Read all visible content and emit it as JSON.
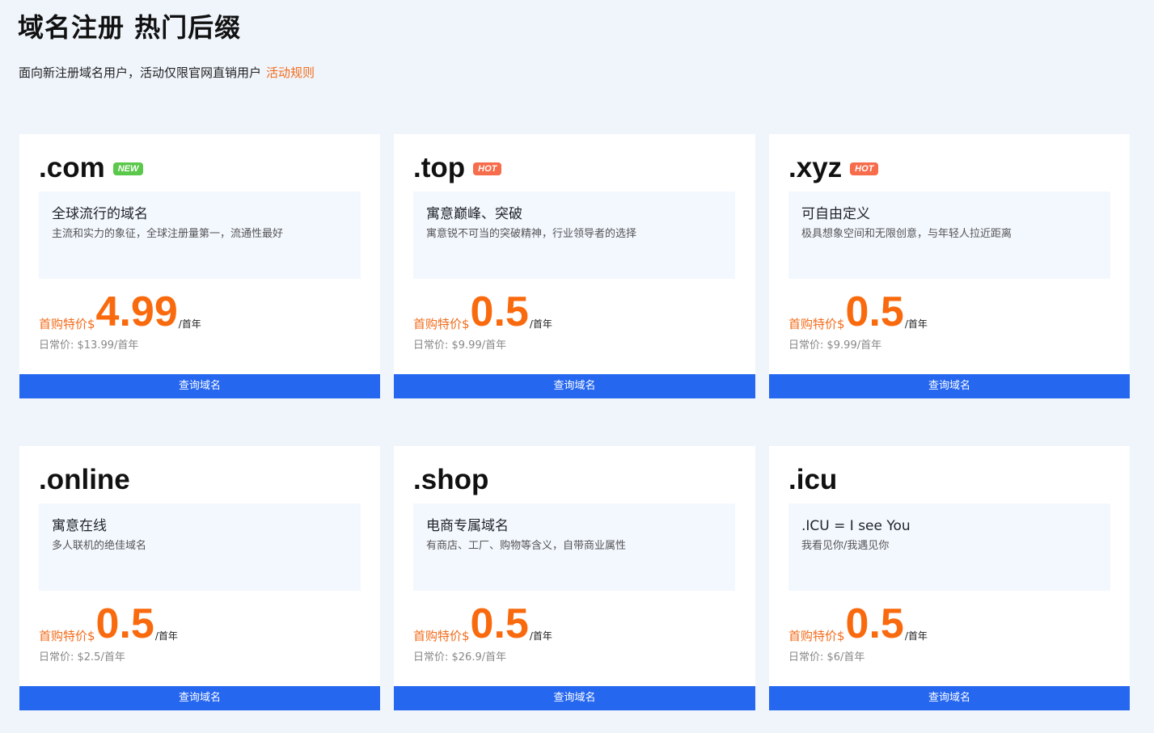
{
  "header": {
    "title": "域名注册 热门后缀",
    "subtitle": "面向新注册域名用户，活动仅限官网直销用户",
    "rules_link": "活动规则"
  },
  "colors": {
    "accent_orange": "#f96a0e",
    "button_blue": "#2667f0",
    "badge_new": "#5ac84b",
    "badge_hot": "#f76c4b",
    "page_bg": "#f0f5fc"
  },
  "cards": [
    {
      "tld": ".com",
      "badge": "NEW",
      "badge_type": "new",
      "desc_title": "全球流行的域名",
      "desc_text": "主流和实力的象征，全球注册量第一，流通性最好",
      "promo_label": "首购特价$",
      "promo_price": "4.99",
      "per_year": "/首年",
      "regular_price": "日常价:  $13.99/首年",
      "button": "查询域名"
    },
    {
      "tld": ".top",
      "badge": "HOT",
      "badge_type": "hot",
      "desc_title": "寓意巅峰、突破",
      "desc_text": "寓意锐不可当的突破精神，行业领导者的选择",
      "promo_label": "首购特价$",
      "promo_price": "0.5",
      "per_year": "/首年",
      "regular_price": "日常价:  $9.99/首年",
      "button": "查询域名"
    },
    {
      "tld": ".xyz",
      "badge": "HOT",
      "badge_type": "hot",
      "desc_title": "可自由定义",
      "desc_text": "极具想象空间和无限创意，与年轻人拉近距离",
      "promo_label": "首购特价$",
      "promo_price": "0.5",
      "per_year": "/首年",
      "regular_price": "日常价:  $9.99/首年",
      "button": "查询域名"
    },
    {
      "tld": ".online",
      "badge": "",
      "badge_type": "",
      "desc_title": "寓意在线",
      "desc_text": "多人联机的绝佳域名",
      "promo_label": "首购特价$",
      "promo_price": "0.5",
      "per_year": "/首年",
      "regular_price": "日常价:  $2.5/首年",
      "button": "查询域名"
    },
    {
      "tld": ".shop",
      "badge": "",
      "badge_type": "",
      "desc_title": "电商专属域名",
      "desc_text": "有商店、工厂、购物等含义，自带商业属性",
      "promo_label": "首购特价$",
      "promo_price": "0.5",
      "per_year": "/首年",
      "regular_price": "日常价:  $26.9/首年",
      "button": "查询域名"
    },
    {
      "tld": ".icu",
      "badge": "",
      "badge_type": "",
      "desc_title": ".ICU = I see You",
      "desc_text": "我看见你/我遇见你",
      "promo_label": "首购特价$",
      "promo_price": "0.5",
      "per_year": "/首年",
      "regular_price": "日常价:  $6/首年",
      "button": "查询域名"
    }
  ]
}
